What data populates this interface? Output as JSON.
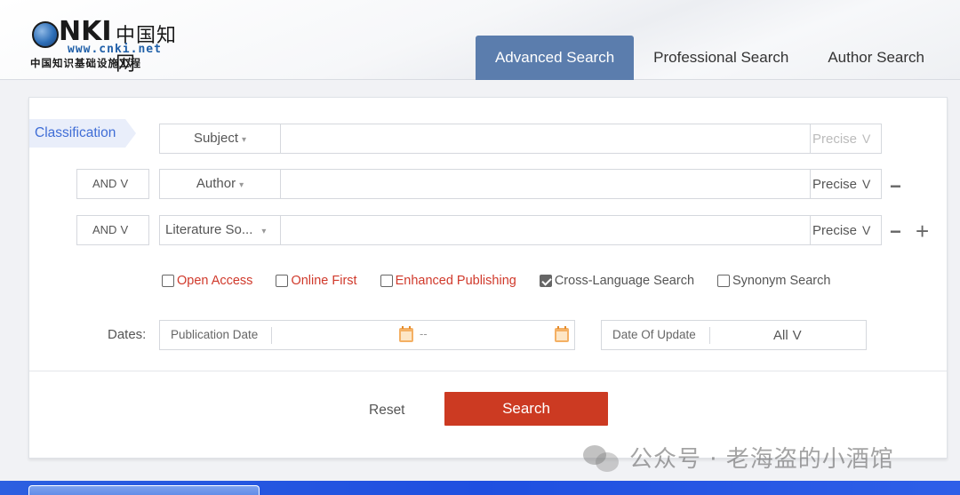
{
  "logo": {
    "letters": "NKI",
    "chinese": "中国知网",
    "url": "www.cnki.net",
    "subtitle": "中国知识基础设施工程"
  },
  "tabs": [
    {
      "label": "Advanced Search",
      "active": true
    },
    {
      "label": "Professional Search",
      "active": false
    },
    {
      "label": "Author Search",
      "active": false
    }
  ],
  "classification_label": "Classification",
  "rows": [
    {
      "field": "Subject",
      "match": "Precise",
      "value": ""
    },
    {
      "logic": "AND",
      "field": "Author",
      "match": "Precise",
      "value": ""
    },
    {
      "logic": "AND",
      "field": "Literature So...",
      "match": "Precise",
      "value": ""
    }
  ],
  "checkboxes": [
    {
      "label": "Open Access",
      "checked": false
    },
    {
      "label": "Online First",
      "checked": false
    },
    {
      "label": "Enhanced Publishing",
      "checked": false
    },
    {
      "label": "Cross-Language Search",
      "checked": true
    },
    {
      "label": "Synonym Search",
      "checked": false
    }
  ],
  "dates": {
    "label": "Dates:",
    "publication_date_label": "Publication Date",
    "range_dash": "--",
    "update_label": "Date Of Update",
    "update_value": "All"
  },
  "buttons": {
    "reset": "Reset",
    "search": "Search"
  },
  "watermark": "公众号 · 老海盗的小酒馆",
  "colors": {
    "tab_active": "#5b7dad",
    "search_button": "#cc3a22",
    "accent_red": "#d0392b",
    "classification_blue": "#3f6dd6"
  }
}
